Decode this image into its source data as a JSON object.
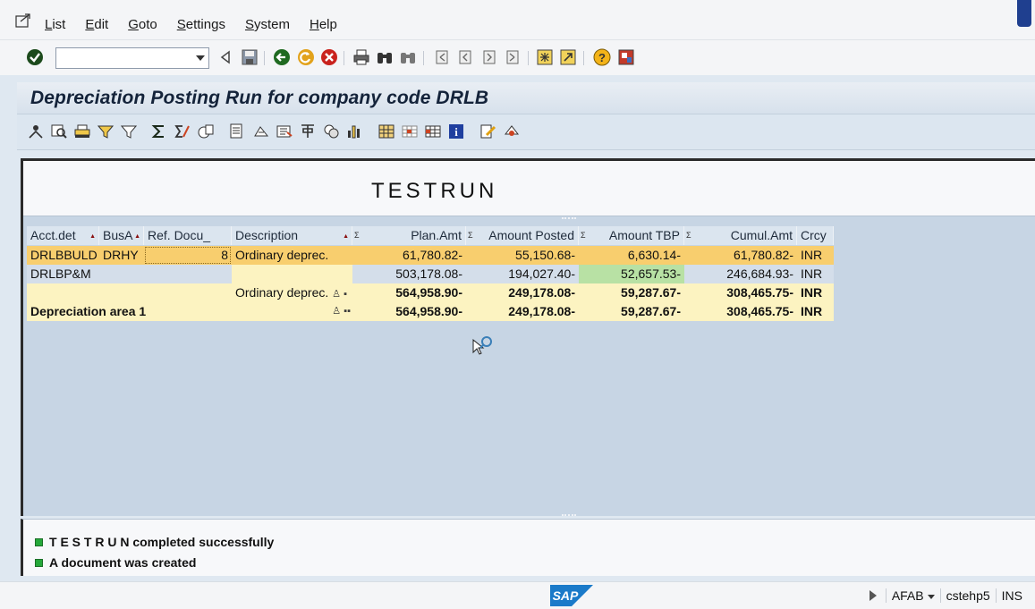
{
  "menu": {
    "items": [
      "List",
      "Edit",
      "Goto",
      "Settings",
      "System",
      "Help"
    ]
  },
  "toolbar": {
    "command_field_value": "",
    "icons": [
      "enter-icon",
      "back-icon",
      "save-icon",
      "green-back-icon",
      "exit-icon",
      "cancel-icon",
      "print-icon",
      "find-icon",
      "find-next-icon",
      "first-page-icon",
      "previous-page-icon",
      "next-page-icon",
      "last-page-icon",
      "create-session-icon",
      "shortcut-icon",
      "help-icon",
      "customize-layout-icon"
    ]
  },
  "title": "Depreciation Posting Run for company code DRLB",
  "alv_toolbar": {
    "icons": [
      "detail-icon",
      "find-icon",
      "print-icon",
      "filter-icon",
      "filter-delete-icon",
      "sum-icon",
      "subtotal-icon",
      "report-icon",
      "export-icon",
      "layout-icon",
      "abc-icon",
      "graphic-icon",
      "grid-icon",
      "choose-layout-icon",
      "save-layout-icon",
      "info-icon",
      "edit-icon",
      "help-icon"
    ]
  },
  "header_text": "TESTRUN",
  "table": {
    "columns": [
      "Acct.det",
      "BusA",
      "Ref. Docu_",
      "Description",
      "Plan.Amt",
      "Amount Posted",
      "Amount TBP",
      "Cumul.Amt",
      "Crcy"
    ],
    "rows": [
      {
        "acct": "DRLBBULD",
        "busa": "DRHY",
        "ref": "8",
        "desc": "Ordinary deprec.",
        "plan": "61,780.82-",
        "posted": "55,150.68-",
        "tbp": "6,630.14-",
        "cumul": "61,780.82-",
        "crcy": "INR"
      },
      {
        "acct": "DRLBP&M",
        "busa": "",
        "ref": "",
        "desc": "",
        "plan": "503,178.08-",
        "posted": "194,027.40-",
        "tbp": "52,657.53-",
        "cumul": "246,684.93-",
        "crcy": "INR"
      },
      {
        "acct": "",
        "busa": "",
        "ref": "",
        "desc": "Ordinary deprec.",
        "plan": "564,958.90-",
        "posted": "249,178.08-",
        "tbp": "59,287.67-",
        "cumul": "308,465.75-",
        "crcy": "INR"
      },
      {
        "acct": "Depreciation area  1",
        "busa": "",
        "ref": "",
        "desc": "",
        "plan": "564,958.90-",
        "posted": "249,178.08-",
        "tbp": "59,287.67-",
        "cumul": "308,465.75-",
        "crcy": "INR"
      }
    ]
  },
  "messages": [
    {
      "text": "T E S T R U N completed successfully",
      "status": "success"
    },
    {
      "text": "A document was created",
      "status": "success"
    }
  ],
  "statusbar": {
    "logo": "SAP",
    "transaction": "AFAB",
    "server": "cstehp5",
    "mode": "INS"
  },
  "colors": {
    "row_highlight": "#f8ce6e",
    "row_normal": "#d4deea",
    "row_total": "#fcf3c1",
    "tbp_cell": "#b8e1a4",
    "header_bg": "#dbe5ef",
    "led_green": "#25a83a"
  }
}
